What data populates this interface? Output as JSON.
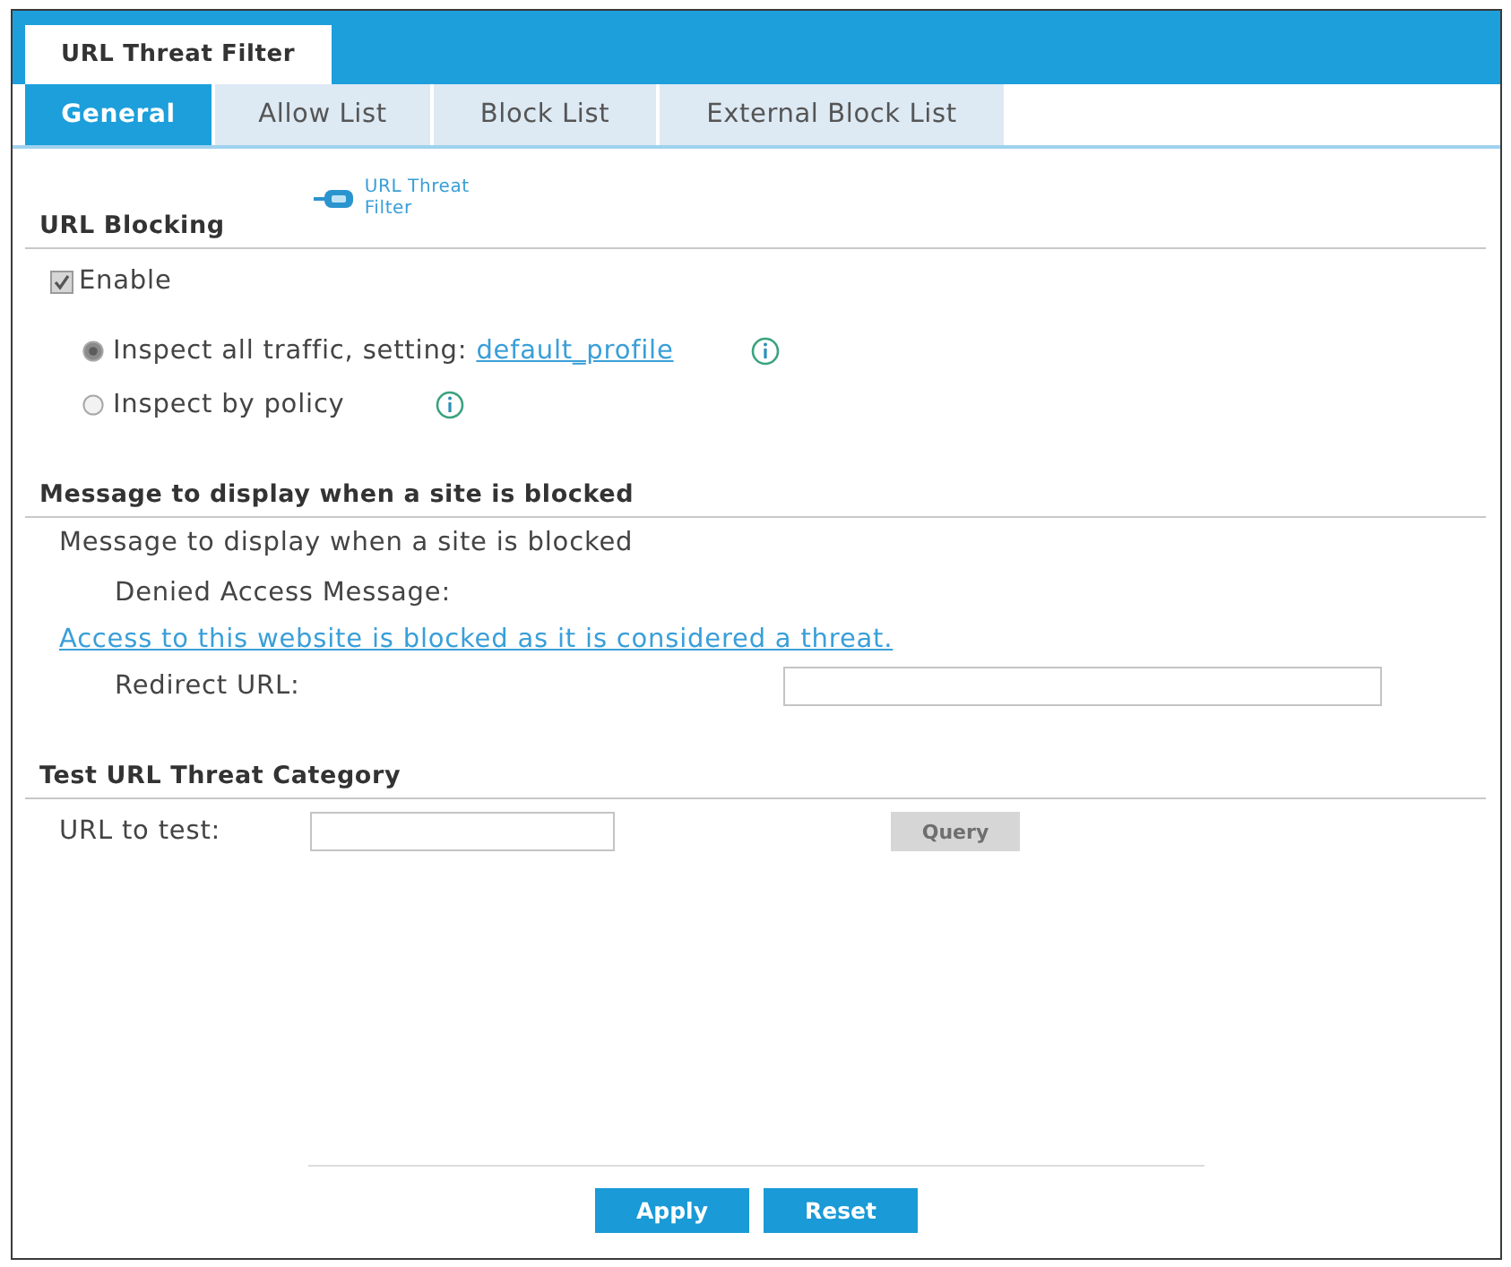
{
  "header_tab": {
    "label": "URL Threat Filter"
  },
  "tabs": [
    {
      "label": "General",
      "selected": true
    },
    {
      "label": "Allow List",
      "selected": false
    },
    {
      "label": "Block List",
      "selected": false
    },
    {
      "label": "External Block List",
      "selected": false
    }
  ],
  "url_blocking": {
    "title": "URL Blocking",
    "feature_link": "URL Threat Filter",
    "enable": {
      "label": "Enable",
      "checked": true
    },
    "options": [
      {
        "label": "Inspect all traffic, setting:",
        "link": "default_profile",
        "selected": true
      },
      {
        "label": "Inspect by policy",
        "selected": false
      }
    ]
  },
  "message_section": {
    "title": "Message to display when a site is blocked",
    "subtitle": "Message to display when a site is blocked",
    "denied_label": "Denied Access Message:",
    "denied_message": "Access to this website is blocked as it is considered a threat.",
    "redirect_label": "Redirect URL:"
  },
  "test_section": {
    "title": "Test URL Threat Category",
    "url_label": "URL to test:",
    "query_button": {
      "label": "Query",
      "disabled": true
    }
  },
  "buttons": [
    {
      "label": "Apply"
    },
    {
      "label": "Reset"
    }
  ]
}
